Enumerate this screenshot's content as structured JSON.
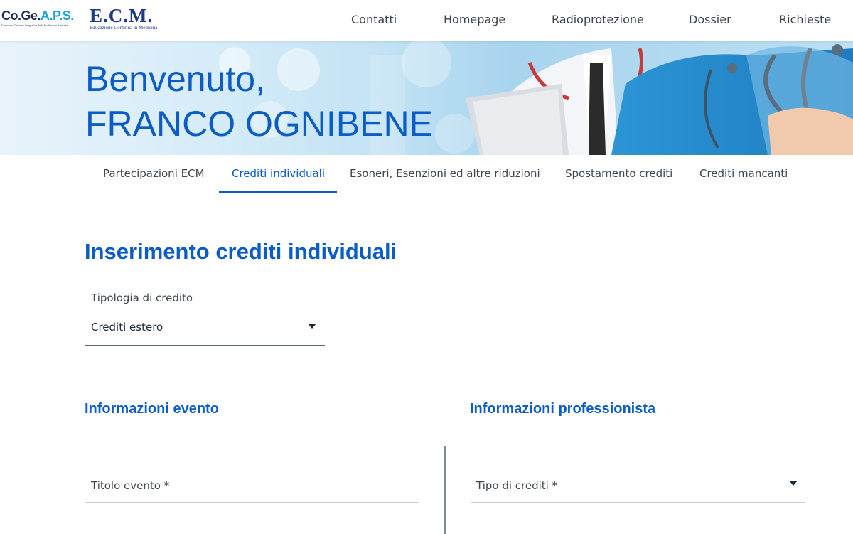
{
  "brand": {
    "cogeaps_name_dark": "Co.Ge.",
    "cogeaps_name_cyan": "A.P.S.",
    "cogeaps_subtitle": "Consorzio Gestione Anagrafica delle Professioni Sanitarie",
    "ecm_name": "E.C.M.",
    "ecm_subtitle": "Educazione Continua in Medicina"
  },
  "topnav": [
    "Contatti",
    "Homepage",
    "Radioprotezione",
    "Dossier",
    "Richieste"
  ],
  "hero": {
    "greeting": "Benvenuto,",
    "user_name": "FRANCO OGNIBENE"
  },
  "subtabs": [
    {
      "label": "Partecipazioni ECM",
      "active": false
    },
    {
      "label": "Crediti individuali",
      "active": true
    },
    {
      "label": "Esoneri, Esenzioni ed altre riduzioni",
      "active": false
    },
    {
      "label": "Spostamento crediti",
      "active": false
    },
    {
      "label": "Crediti mancanti",
      "active": false
    }
  ],
  "main": {
    "title": "Inserimento crediti individuali",
    "credit_type": {
      "label": "Tipologia di credito",
      "value": "Crediti estero"
    },
    "event_section": {
      "title": "Informazioni evento",
      "event_title_placeholder": "Titolo evento *"
    },
    "professional_section": {
      "title": "Informazioni professionista",
      "credit_kind_placeholder": "Tipo di crediti *"
    }
  },
  "colors": {
    "accent": "#0b5cc7",
    "text": "#3d4752",
    "divider": "#7d8a98"
  },
  "icons": [
    "chevron-down-icon"
  ]
}
